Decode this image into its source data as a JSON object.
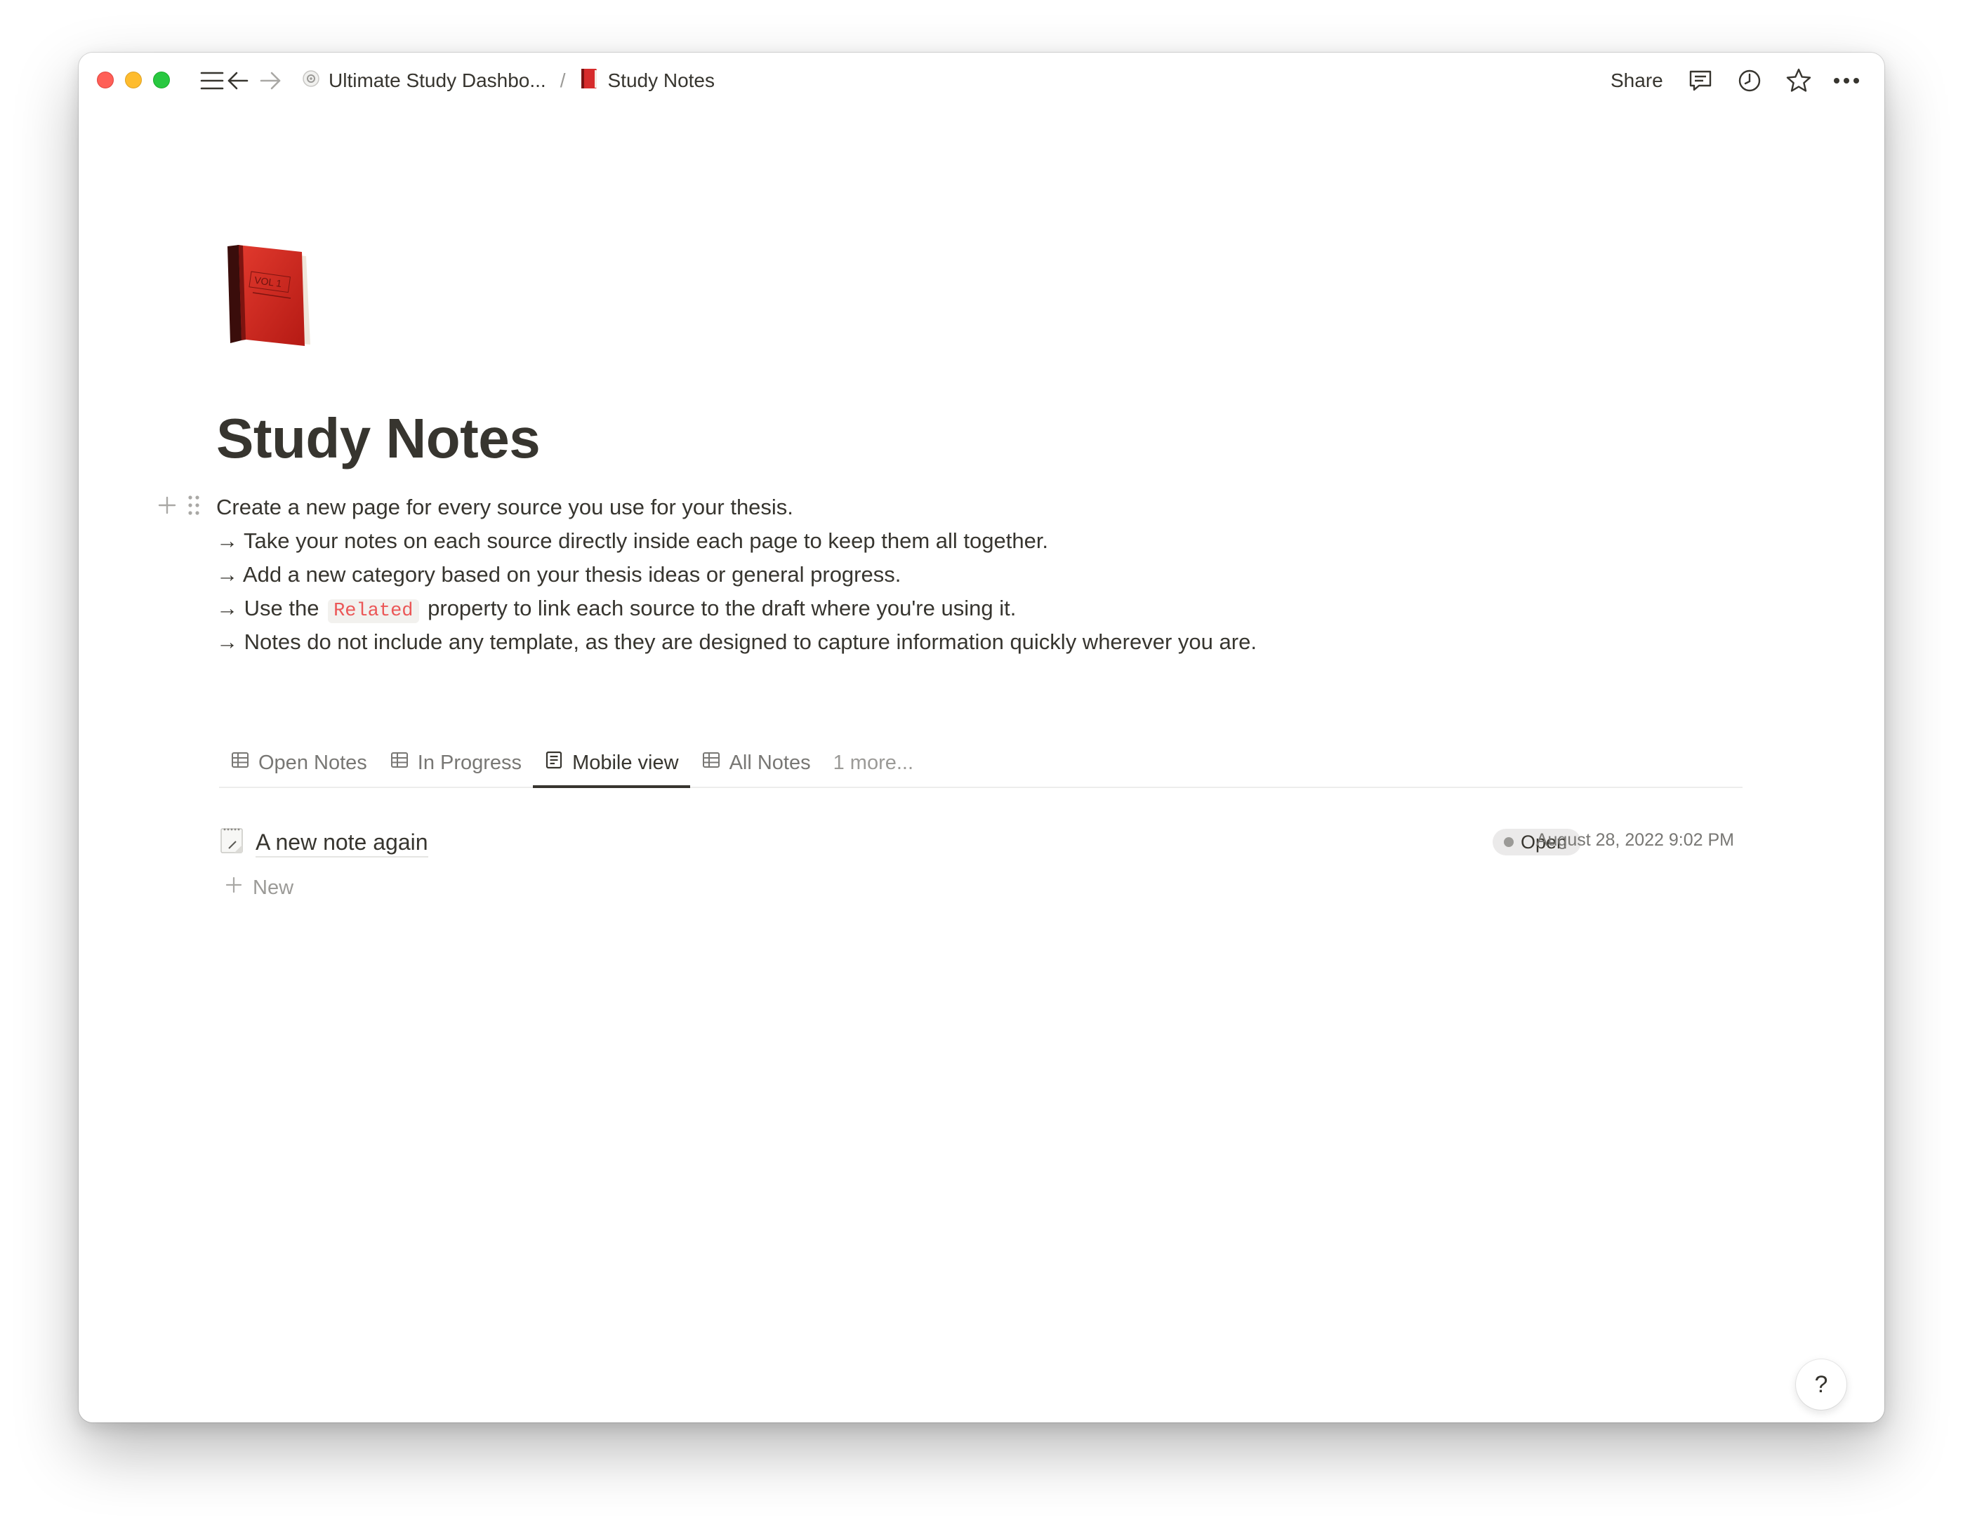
{
  "titlebar": {
    "breadcrumb": [
      {
        "label": "Ultimate Study Dashbo..."
      },
      {
        "label": "Study Notes"
      }
    ],
    "separator": "/",
    "share_label": "Share"
  },
  "page": {
    "title": "Study Notes",
    "description": {
      "line1": "Create a new page for every source you use for your thesis.",
      "line2": "→ Take your notes on each source directly inside each page to keep them all together.",
      "line3": "→ Add a new category based on your thesis ideas or general progress.",
      "line4_prefix": "→ Use the",
      "line4_code": "Related",
      "line4_suffix": "property to link each source to the draft where you're using it.",
      "line5": "→ Notes do not include any template, as they are designed to capture information quickly wherever you are."
    }
  },
  "views": {
    "tabs": [
      {
        "label": "Open Notes",
        "icon": "table-icon"
      },
      {
        "label": "In Progress",
        "icon": "table-icon"
      },
      {
        "label": "Mobile view",
        "icon": "list-view-icon",
        "active": true
      },
      {
        "label": "All Notes",
        "icon": "table-icon"
      }
    ],
    "more_label": "1 more..."
  },
  "notes": [
    {
      "title": "A new note again",
      "status": "Open",
      "date": "August 28, 2022 9:02 PM"
    }
  ],
  "new_label": "New",
  "help_label": "?",
  "colors": {
    "text": "#37352f",
    "muted": "#787774",
    "code_text": "#eb5757",
    "code_bg": "#f2f1ee",
    "badge_bg": "#ebeaea"
  }
}
